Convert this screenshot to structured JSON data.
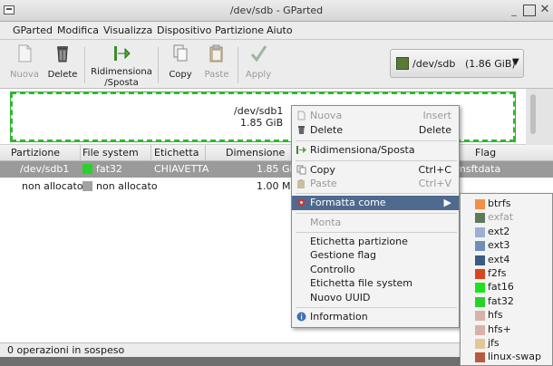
{
  "window": {
    "title": "/dev/sdb - GParted"
  },
  "menubar": [
    {
      "label": "GParted"
    },
    {
      "label": "Modifica"
    },
    {
      "label": "Visualizza"
    },
    {
      "label": "Dispositivo"
    },
    {
      "label": "Partizione"
    },
    {
      "label": "Aiuto"
    }
  ],
  "toolbar": {
    "new_label": "Nuova",
    "delete_label": "Delete",
    "resize_label_1": "Ridimensiona",
    "resize_label_2": "/Sposta",
    "copy_label": "Copy",
    "paste_label": "Paste",
    "apply_label": "Apply",
    "device_name": "/dev/sdb",
    "device_size": "(1.86 GiB)"
  },
  "graphic": {
    "partition_name": "/dev/sdb1",
    "partition_size": "1.85 GiB"
  },
  "table": {
    "headers": [
      "Partizione",
      "File system",
      "Etichetta",
      "Dimensione",
      "Flag"
    ],
    "rows": [
      {
        "partition": "/dev/sdb1",
        "filesystem": "fat32",
        "fs_color": "#2ad12a",
        "label": "CHIAVETTA",
        "size": "1.85 GiB",
        "flag": "msftdata"
      },
      {
        "partition": "non allocato",
        "filesystem": "non allocato",
        "fs_color": "#a2a2a2",
        "label": "",
        "size": "1.00 MiB",
        "flag": ""
      }
    ]
  },
  "status": {
    "text": "0 operazioni in sospeso"
  },
  "context_menu": {
    "nuova": "Nuova",
    "nuova_acc": "Insert",
    "delete": "Delete",
    "delete_acc": "Delete",
    "resize": "Ridimensiona/Sposta",
    "copy": "Copy",
    "copy_acc": "Ctrl+C",
    "paste": "Paste",
    "paste_acc": "Ctrl+V",
    "format": "Formatta come",
    "monta": "Monta",
    "etichetta": "Etichetta partizione",
    "flag": "Gestione flag",
    "controllo": "Controllo",
    "etichetta_fs": "Etichetta file system",
    "uuid": "Nuovo UUID",
    "info": "Information"
  },
  "submenu": [
    {
      "label": "btrfs",
      "color": "#f29046",
      "enabled": true
    },
    {
      "label": "exfat",
      "color": "#5a7a5a",
      "enabled": false
    },
    {
      "label": "ext2",
      "color": "#9bb1d3",
      "enabled": true
    },
    {
      "label": "ext3",
      "color": "#6f8fb8",
      "enabled": true
    },
    {
      "label": "ext4",
      "color": "#3d5a82",
      "enabled": true
    },
    {
      "label": "f2fs",
      "color": "#d9461e",
      "enabled": true
    },
    {
      "label": "fat16",
      "color": "#1ee21e",
      "enabled": true
    },
    {
      "label": "fat32",
      "color": "#2ad12a",
      "enabled": true
    },
    {
      "label": "hfs",
      "color": "#d8b2a8",
      "enabled": true
    },
    {
      "label": "hfs+",
      "color": "#d8b2a8",
      "enabled": true
    },
    {
      "label": "jfs",
      "color": "#e3c69a",
      "enabled": true
    },
    {
      "label": "linux-swap",
      "color": "#b55a3e",
      "enabled": true
    }
  ]
}
